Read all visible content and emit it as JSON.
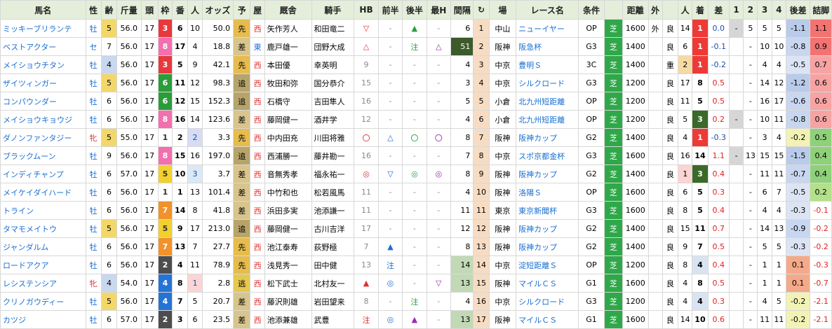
{
  "headers": [
    "馬名",
    "性",
    "齢",
    "斤量",
    "頭",
    "枠",
    "番",
    "人",
    "オッズ",
    "予",
    "屋",
    "厩舎",
    "騎手",
    "HB",
    "前半",
    "後半",
    "最H",
    "間隔",
    "↻",
    "場",
    "レース名",
    "条件",
    "",
    "距離",
    "外",
    "",
    "人",
    "着",
    "差",
    "1",
    "2",
    "3",
    "4",
    "後差",
    "詰脚"
  ],
  "colors": {
    "header_bg": "#e5eeda",
    "frame": {
      "1": "#ffffff",
      "2": "#4d4d4d",
      "3": "#e8383d",
      "4": "#2673d6",
      "5": "#f2d02e",
      "6": "#2a9d3a",
      "7": "#f2922b",
      "8": "#f36fae"
    },
    "tenkai": {
      "先": "#e6bc4f",
      "差": "#d8c58d",
      "追": "#b7a46a",
      "逃": "#e4c850"
    },
    "turf": "#2fa84a"
  },
  "rows": [
    {
      "name": "ミッキーブリランテ",
      "sex": "牡",
      "age": "5",
      "kinryo": "56.0",
      "heads": "17",
      "frame": "3",
      "num": "6",
      "pop": "10",
      "odds": "50.0",
      "tenkai": "先",
      "region": "西",
      "trainer": "矢作芳人",
      "jockey": "和田竜二",
      "hb": "▽",
      "hb_c": "red",
      "zenhan": "-",
      "kouhan": "▲",
      "kouhan_c": "green",
      "saih": "-",
      "interval": "6",
      "seq": "1",
      "place": "中山",
      "race": "ニューイヤー",
      "cond": "OP",
      "surf": "芝",
      "dist": "1600",
      "out": "外",
      "baba": "良",
      "rpop": "14",
      "chaku": "1",
      "diff": "0.0",
      "c1": "-",
      "c2": "5",
      "c3": "5",
      "c4": "5",
      "kosa": "-1.1",
      "tsume": "1.1"
    },
    {
      "name": "ベストアクター",
      "sex": "セ",
      "age": "7",
      "kinryo": "56.0",
      "heads": "17",
      "frame": "8",
      "num": "17",
      "pop": "4",
      "odds": "18.8",
      "tenkai": "差",
      "region": "東",
      "trainer": "鹿戸雄一",
      "jockey": "団野大成",
      "hb": "△",
      "hb_c": "red",
      "zenhan": "-",
      "kouhan": "注",
      "kouhan_c": "green",
      "saih": "△",
      "saih_c": "purple",
      "interval": "51",
      "seq": "2",
      "place": "阪神",
      "race": "阪急杯",
      "cond": "G3",
      "surf": "芝",
      "dist": "1400",
      "out": "",
      "baba": "良",
      "rpop": "6",
      "chaku": "1",
      "diff": "-0.1",
      "c1": "",
      "c2": "-",
      "c3": "10",
      "c4": "10",
      "kosa": "-0.8",
      "tsume": "0.9"
    },
    {
      "name": "メイショウチタン",
      "sex": "牡",
      "age": "4",
      "kinryo": "56.0",
      "heads": "17",
      "frame": "3",
      "num": "5",
      "pop": "9",
      "odds": "42.1",
      "tenkai": "先",
      "region": "西",
      "trainer": "本田優",
      "jockey": "幸英明",
      "hb": "9",
      "hb_c": "gray",
      "zenhan": "-",
      "kouhan": "-",
      "saih": "-",
      "interval": "4",
      "seq": "3",
      "place": "中京",
      "race": "豊明Ｓ",
      "cond": "3C",
      "surf": "芝",
      "dist": "1400",
      "out": "",
      "baba": "重",
      "rpop": "2",
      "chaku": "1",
      "diff": "-0.2",
      "c1": "",
      "c2": "-",
      "c3": "4",
      "c4": "4",
      "kosa": "-0.5",
      "tsume": "0.7"
    },
    {
      "name": "ザイツィンガー",
      "sex": "牡",
      "age": "5",
      "kinryo": "56.0",
      "heads": "17",
      "frame": "6",
      "num": "11",
      "pop": "12",
      "odds": "98.3",
      "tenkai": "追",
      "region": "西",
      "trainer": "牧田和弥",
      "jockey": "国分恭介",
      "hb": "15",
      "hb_c": "gray",
      "zenhan": "-",
      "kouhan": "-",
      "saih": "-",
      "interval": "3",
      "seq": "4",
      "place": "中京",
      "race": "シルクロード",
      "cond": "G3",
      "surf": "芝",
      "dist": "1200",
      "out": "",
      "baba": "良",
      "rpop": "17",
      "chaku": "8",
      "diff": "0.5",
      "c1": "",
      "c2": "-",
      "c3": "14",
      "c4": "12",
      "kosa": "-1.2",
      "tsume": "0.6"
    },
    {
      "name": "コンパウンダー",
      "sex": "牡",
      "age": "6",
      "kinryo": "56.0",
      "heads": "17",
      "frame": "6",
      "num": "12",
      "pop": "15",
      "odds": "152.3",
      "tenkai": "追",
      "region": "西",
      "trainer": "石橋守",
      "jockey": "吉田隼人",
      "hb": "16",
      "hb_c": "gray",
      "zenhan": "-",
      "kouhan": "-",
      "saih": "-",
      "interval": "5",
      "seq": "5",
      "place": "小倉",
      "race": "北九州短距離",
      "cond": "OP",
      "surf": "芝",
      "dist": "1200",
      "out": "",
      "baba": "良",
      "rpop": "11",
      "chaku": "5",
      "diff": "0.5",
      "c1": "",
      "c2": "-",
      "c3": "16",
      "c4": "17",
      "kosa": "-0.6",
      "tsume": "0.6"
    },
    {
      "name": "メイショウキョウジ",
      "sex": "牡",
      "age": "6",
      "kinryo": "56.0",
      "heads": "17",
      "frame": "8",
      "num": "16",
      "pop": "14",
      "odds": "123.6",
      "tenkai": "差",
      "region": "西",
      "trainer": "藤岡健一",
      "jockey": "酒井学",
      "hb": "12",
      "hb_c": "gray",
      "zenhan": "-",
      "kouhan": "-",
      "saih": "-",
      "interval": "4",
      "seq": "6",
      "place": "小倉",
      "race": "北九州短距離",
      "cond": "OP",
      "surf": "芝",
      "dist": "1200",
      "out": "",
      "baba": "良",
      "rpop": "5",
      "chaku": "3",
      "diff": "0.2",
      "c1": "-",
      "c2": "-",
      "c3": "10",
      "c4": "11",
      "kosa": "-0.8",
      "tsume": "0.6"
    },
    {
      "name": "ダノンファンタジー",
      "sex": "牝",
      "age": "5",
      "kinryo": "55.0",
      "heads": "17",
      "frame": "1",
      "num": "2",
      "pop": "2",
      "odds": "3.3",
      "tenkai": "先",
      "region": "西",
      "trainer": "中内田充",
      "jockey": "川田将雅",
      "hb": "〇",
      "hb_c": "red",
      "zenhan": "△",
      "zenhan_c": "blue",
      "kouhan": "〇",
      "kouhan_c": "green",
      "saih": "〇",
      "saih_c": "purple",
      "interval": "8",
      "seq": "7",
      "place": "阪神",
      "race": "阪神カップ",
      "cond": "G2",
      "surf": "芝",
      "dist": "1400",
      "out": "",
      "baba": "良",
      "rpop": "4",
      "chaku": "1",
      "diff": "-0.3",
      "c1": "",
      "c2": "-",
      "c3": "3",
      "c4": "4",
      "kosa": "-0.2",
      "tsume": "0.5"
    },
    {
      "name": "ブラックムーン",
      "sex": "牡",
      "age": "9",
      "kinryo": "56.0",
      "heads": "17",
      "frame": "8",
      "num": "15",
      "pop": "16",
      "odds": "197.0",
      "tenkai": "追",
      "region": "西",
      "trainer": "西浦勝一",
      "jockey": "藤井勘一",
      "hb": "16",
      "hb_c": "gray",
      "zenhan": "-",
      "kouhan": "-",
      "saih": "-",
      "interval": "7",
      "seq": "8",
      "place": "中京",
      "race": "スポ京都金杯",
      "cond": "G3",
      "surf": "芝",
      "dist": "1600",
      "out": "",
      "baba": "良",
      "rpop": "16",
      "chaku": "14",
      "diff": "1.1",
      "c1": "-",
      "c2": "13",
      "c3": "15",
      "c4": "15",
      "kosa": "-1.5",
      "tsume": "0.4"
    },
    {
      "name": "インディチャンプ",
      "sex": "牡",
      "age": "6",
      "kinryo": "57.0",
      "heads": "17",
      "frame": "5",
      "num": "10",
      "pop": "3",
      "odds": "3.7",
      "tenkai": "差",
      "region": "西",
      "trainer": "音無秀孝",
      "jockey": "福永祐一",
      "hb": "◎",
      "hb_c": "red",
      "zenhan": "▽",
      "zenhan_c": "blue",
      "kouhan": "◎",
      "kouhan_c": "green",
      "saih": "◎",
      "saih_c": "purple",
      "interval": "8",
      "seq": "9",
      "place": "阪神",
      "race": "阪神カップ",
      "cond": "G2",
      "surf": "芝",
      "dist": "1400",
      "out": "",
      "baba": "良",
      "rpop": "1",
      "chaku": "3",
      "diff": "0.4",
      "c1": "",
      "c2": "-",
      "c3": "11",
      "c4": "11",
      "kosa": "-0.7",
      "tsume": "0.4"
    },
    {
      "name": "メイケイダイハード",
      "sex": "牡",
      "age": "6",
      "kinryo": "56.0",
      "heads": "17",
      "frame": "1",
      "num": "1",
      "pop": "13",
      "odds": "101.4",
      "tenkai": "差",
      "region": "西",
      "trainer": "中竹和也",
      "jockey": "松若風馬",
      "hb": "11",
      "hb_c": "gray",
      "zenhan": "-",
      "kouhan": "-",
      "saih": "-",
      "interval": "4",
      "seq": "10",
      "place": "阪神",
      "race": "洛陽Ｓ",
      "cond": "OP",
      "surf": "芝",
      "dist": "1600",
      "out": "",
      "baba": "良",
      "rpop": "6",
      "chaku": "5",
      "diff": "0.3",
      "c1": "",
      "c2": "-",
      "c3": "6",
      "c4": "7",
      "kosa": "-0.5",
      "tsume": "0.2"
    },
    {
      "name": "トライン",
      "sex": "牡",
      "age": "6",
      "kinryo": "56.0",
      "heads": "17",
      "frame": "7",
      "num": "14",
      "pop": "8",
      "odds": "41.8",
      "tenkai": "差",
      "region": "西",
      "trainer": "浜田多実",
      "jockey": "池添謙一",
      "hb": "11",
      "hb_c": "gray",
      "zenhan": "-",
      "kouhan": "-",
      "saih": "-",
      "interval": "11",
      "seq": "11",
      "place": "東京",
      "race": "東京新聞杯",
      "cond": "G3",
      "surf": "芝",
      "dist": "1600",
      "out": "",
      "baba": "良",
      "rpop": "8",
      "chaku": "5",
      "diff": "0.4",
      "c1": "",
      "c2": "-",
      "c3": "4",
      "c4": "4",
      "kosa": "-0.3",
      "tsume": "-0.1"
    },
    {
      "name": "タマモメイトウ",
      "sex": "牡",
      "age": "5",
      "kinryo": "56.0",
      "heads": "17",
      "frame": "5",
      "num": "9",
      "pop": "17",
      "odds": "213.0",
      "tenkai": "追",
      "region": "西",
      "trainer": "藤岡健一",
      "jockey": "古川吉洋",
      "hb": "17",
      "hb_c": "gray",
      "zenhan": "-",
      "kouhan": "-",
      "saih": "-",
      "interval": "12",
      "seq": "12",
      "place": "阪神",
      "race": "阪神カップ",
      "cond": "G2",
      "surf": "芝",
      "dist": "1400",
      "out": "",
      "baba": "良",
      "rpop": "15",
      "chaku": "11",
      "diff": "0.7",
      "c1": "",
      "c2": "-",
      "c3": "14",
      "c4": "13",
      "kosa": "-0.9",
      "tsume": "-0.2"
    },
    {
      "name": "ジャンダルム",
      "sex": "牡",
      "age": "6",
      "kinryo": "56.0",
      "heads": "17",
      "frame": "7",
      "num": "13",
      "pop": "7",
      "odds": "27.7",
      "tenkai": "先",
      "region": "西",
      "trainer": "池江泰寿",
      "jockey": "荻野極",
      "hb": "7",
      "hb_c": "gray",
      "zenhan": "▲",
      "zenhan_c": "blue",
      "kouhan": "-",
      "saih": "-",
      "interval": "8",
      "seq": "13",
      "place": "阪神",
      "race": "阪神カップ",
      "cond": "G2",
      "surf": "芝",
      "dist": "1400",
      "out": "",
      "baba": "良",
      "rpop": "9",
      "chaku": "7",
      "diff": "0.5",
      "c1": "",
      "c2": "-",
      "c3": "5",
      "c4": "5",
      "kosa": "-0.3",
      "tsume": "-0.2"
    },
    {
      "name": "ロードアクア",
      "sex": "牡",
      "age": "6",
      "kinryo": "56.0",
      "heads": "17",
      "frame": "2",
      "num": "4",
      "pop": "11",
      "odds": "78.9",
      "tenkai": "先",
      "region": "西",
      "trainer": "浅見秀一",
      "jockey": "田中健",
      "hb": "13",
      "hb_c": "gray",
      "zenhan": "注",
      "zenhan_c": "blue",
      "kouhan": "-",
      "saih": "-",
      "interval": "14",
      "seq": "14",
      "place": "中京",
      "race": "淀短距離Ｓ",
      "cond": "OP",
      "surf": "芝",
      "dist": "1200",
      "out": "",
      "baba": "良",
      "rpop": "8",
      "chaku": "4",
      "diff": "0.4",
      "c1": "",
      "c2": "-",
      "c3": "1",
      "c4": "1",
      "kosa": "0.1",
      "tsume": "-0.3"
    },
    {
      "name": "レシステンシア",
      "sex": "牝",
      "age": "4",
      "kinryo": "54.0",
      "heads": "17",
      "frame": "4",
      "num": "8",
      "pop": "1",
      "odds": "2.8",
      "tenkai": "逃",
      "region": "西",
      "trainer": "松下武士",
      "jockey": "北村友一",
      "hb": "▲",
      "hb_c": "red",
      "zenhan": "◎",
      "zenhan_c": "blue",
      "kouhan": "-",
      "saih": "▽",
      "saih_c": "purple",
      "interval": "13",
      "seq": "15",
      "place": "阪神",
      "race": "マイルＣＳ",
      "cond": "G1",
      "surf": "芝",
      "dist": "1600",
      "out": "",
      "baba": "良",
      "rpop": "4",
      "chaku": "8",
      "diff": "0.5",
      "c1": "",
      "c2": "-",
      "c3": "1",
      "c4": "1",
      "kosa": "0.1",
      "tsume": "-0.7"
    },
    {
      "name": "クリノガウディー",
      "sex": "牡",
      "age": "5",
      "kinryo": "56.0",
      "heads": "17",
      "frame": "4",
      "num": "7",
      "pop": "5",
      "odds": "20.7",
      "tenkai": "差",
      "region": "西",
      "trainer": "藤沢則雄",
      "jockey": "岩田望来",
      "hb": "8",
      "hb_c": "gray",
      "zenhan": "-",
      "kouhan": "注",
      "kouhan_c": "green",
      "saih": "-",
      "interval": "4",
      "seq": "16",
      "place": "中京",
      "race": "シルクロード",
      "cond": "G3",
      "surf": "芝",
      "dist": "1200",
      "out": "",
      "baba": "良",
      "rpop": "4",
      "chaku": "4",
      "diff": "0.3",
      "c1": "",
      "c2": "-",
      "c3": "4",
      "c4": "5",
      "kosa": "-0.2",
      "tsume": "-2.1"
    },
    {
      "name": "カツジ",
      "sex": "牡",
      "age": "6",
      "kinryo": "57.0",
      "heads": "17",
      "frame": "2",
      "num": "3",
      "pop": "6",
      "odds": "23.5",
      "tenkai": "差",
      "region": "西",
      "trainer": "池添兼雄",
      "jockey": "武豊",
      "hb": "注",
      "hb_c": "red",
      "zenhan": "◎",
      "zenhan_c": "blue",
      "kouhan": "▲",
      "kouhan_c": "purple",
      "saih": "-",
      "interval": "13",
      "seq": "17",
      "place": "阪神",
      "race": "マイルＣＳ",
      "cond": "G1",
      "surf": "芝",
      "dist": "1600",
      "out": "",
      "baba": "良",
      "rpop": "14",
      "chaku": "10",
      "diff": "0.6",
      "c1": "",
      "c2": "-",
      "c3": "11",
      "c4": "11",
      "kosa": "-0.2",
      "tsume": "-2.1"
    }
  ]
}
